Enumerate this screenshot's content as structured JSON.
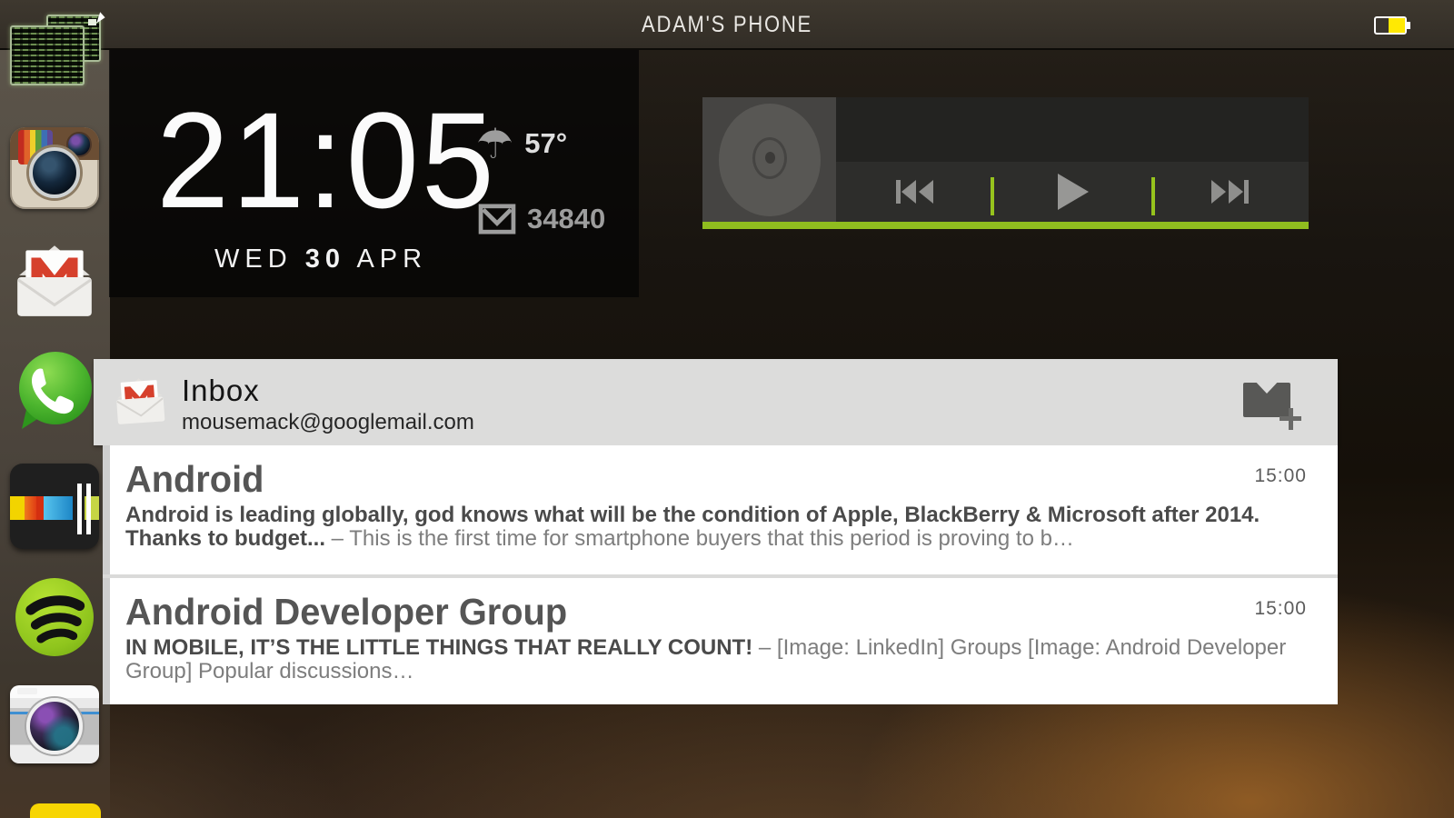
{
  "statusbar": {
    "title": "ADAM'S PHONE",
    "battery_icon": "battery-half-icon",
    "battery_fill_color": "#ffe903"
  },
  "sidebar": {
    "apps": [
      {
        "name": "terminal-app-icon"
      },
      {
        "name": "instagram-app-icon"
      },
      {
        "name": "gmail-app-icon"
      },
      {
        "name": "whatsapp-app-icon"
      },
      {
        "name": "stitcher-app-icon"
      },
      {
        "name": "spotify-app-icon"
      },
      {
        "name": "camera-app-icon"
      },
      {
        "name": "snapchat-app-icon-partial"
      }
    ]
  },
  "clock_widget": {
    "time": "21:05",
    "weekday": "WED",
    "day": "30",
    "month": "APR",
    "weather_icon": "umbrella-icon",
    "umbrella_glyph": "☂",
    "temperature": "57°",
    "mail_icon": "gmail-envelope-icon",
    "mail_count": "34840"
  },
  "music_widget": {
    "album_art_icon": "disc-icon",
    "buttons": [
      {
        "name": "previous-track-icon"
      },
      {
        "name": "play-icon"
      },
      {
        "name": "next-track-icon"
      }
    ],
    "progress_color": "#90bd1f"
  },
  "gmail_widget": {
    "icon": "gmail-envelope-icon",
    "title": "Inbox",
    "account": "mousemack@googlemail.com",
    "compose_icon": "compose-new-email-icon",
    "emails": [
      {
        "sender": "Android",
        "time": "15:00",
        "subject": "Android is leading globally, god knows what will be the condition of Apple, BlackBerry & Microsoft after 2014.  Thanks to budget...",
        "snippet": "– This is the first time for smartphone buyers that this period is proving to b…"
      },
      {
        "sender": "Android Developer Group",
        "time": "15:00",
        "subject": "IN MOBILE, IT’S THE LITTLE THINGS THAT REALLY COUNT!",
        "snippet": "– [Image: LinkedIn] Groups [Image: Android Developer Group] Popular discussions…"
      }
    ]
  },
  "colors": {
    "accent_green": "#90bd1f",
    "gmail_red": "#d6402c",
    "header_gray": "#dcdcdb",
    "statusbar_bg": "#38332c",
    "battery_yellow": "#ffe903"
  }
}
